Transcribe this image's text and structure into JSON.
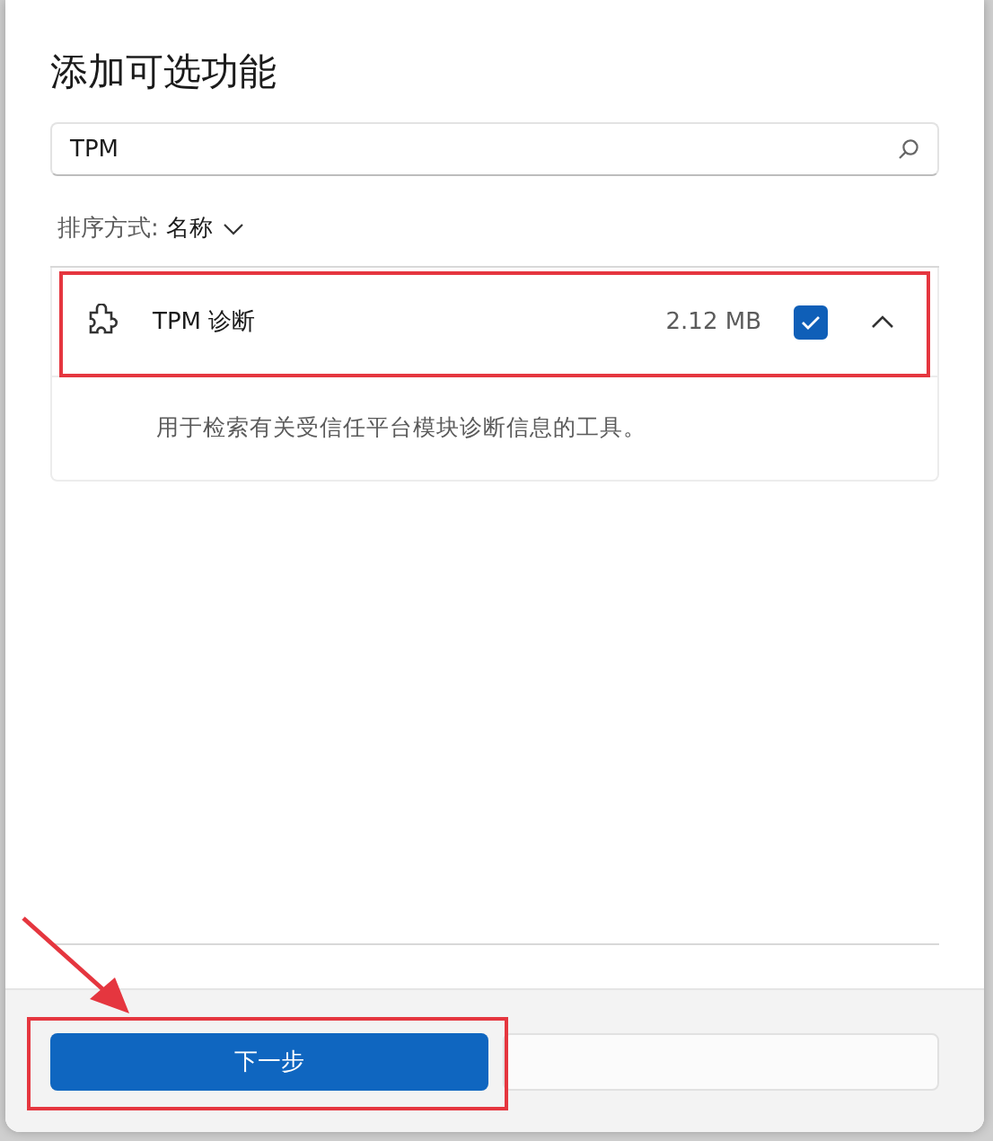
{
  "dialog": {
    "title": "添加可选功能"
  },
  "search": {
    "value": "TPM"
  },
  "sort": {
    "label": "排序方式:",
    "value": "名称"
  },
  "features": [
    {
      "name": "TPM 诊断",
      "size": "2.12 MB",
      "checked": true,
      "expanded": true,
      "description": "用于检索有关受信任平台模块诊断信息的工具。",
      "highlighted": true
    }
  ],
  "footer": {
    "primary_button": "下一步",
    "primary_highlighted": true
  }
}
